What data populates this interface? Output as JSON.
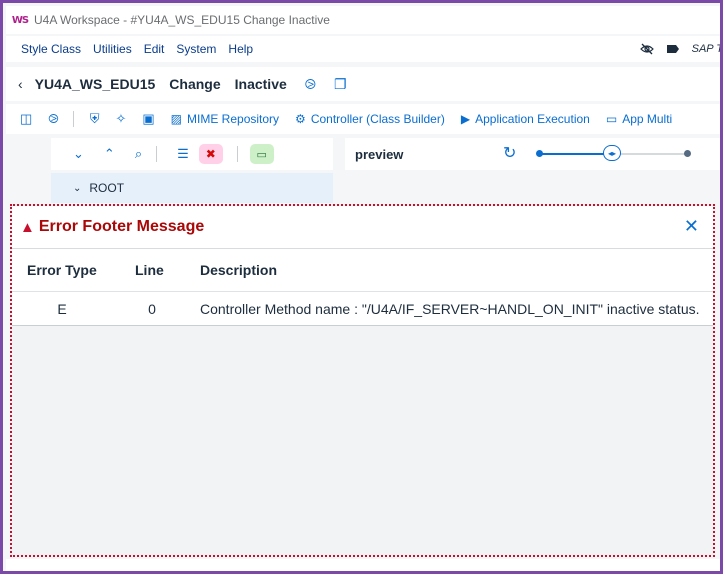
{
  "window": {
    "logo_text": "WS",
    "title": "U4A Workspace - #YU4A_WS_EDU15 Change Inactive"
  },
  "menu": {
    "items": [
      "Style Class",
      "Utilities",
      "Edit",
      "System",
      "Help"
    ],
    "right_label": "SAP T"
  },
  "header": {
    "app_name": "YU4A_WS_EDU15",
    "mode": "Change",
    "status": "Inactive"
  },
  "toolbar": {
    "mime_label": "MIME Repository",
    "controller_label": "Controller (Class Builder)",
    "execution_label": "Application Execution",
    "multi_label": "App Multi"
  },
  "tree": {
    "root_label": "ROOT"
  },
  "preview": {
    "title": "preview",
    "slider_value": 0.48
  },
  "popup": {
    "title": "Error Footer Message",
    "columns": [
      "Error Type",
      "Line",
      "Description"
    ],
    "rows": [
      {
        "type": "E",
        "line": "0",
        "description": "Controller Method name : \"/U4A/IF_SERVER~HANDL_ON_INIT\" inactive status."
      }
    ]
  },
  "colors": {
    "accent": "#0a6ed1",
    "error": "#c8102e",
    "frame": "#7b4aa8"
  },
  "icons": {
    "header": [
      "back-icon",
      "binoculars-icon",
      "new-doc-icon"
    ],
    "toolbar": [
      "panel-icon",
      "binoculars-icon",
      "shield-icon",
      "magic-wand-icon",
      "save-icon",
      "image-icon",
      "gear-icon",
      "run-icon",
      "device-icon"
    ],
    "tree_toolbar": [
      "expand-all-icon",
      "collapse-all-icon",
      "search-icon",
      "list-icon",
      "delete-icon",
      "display-icon"
    ]
  }
}
